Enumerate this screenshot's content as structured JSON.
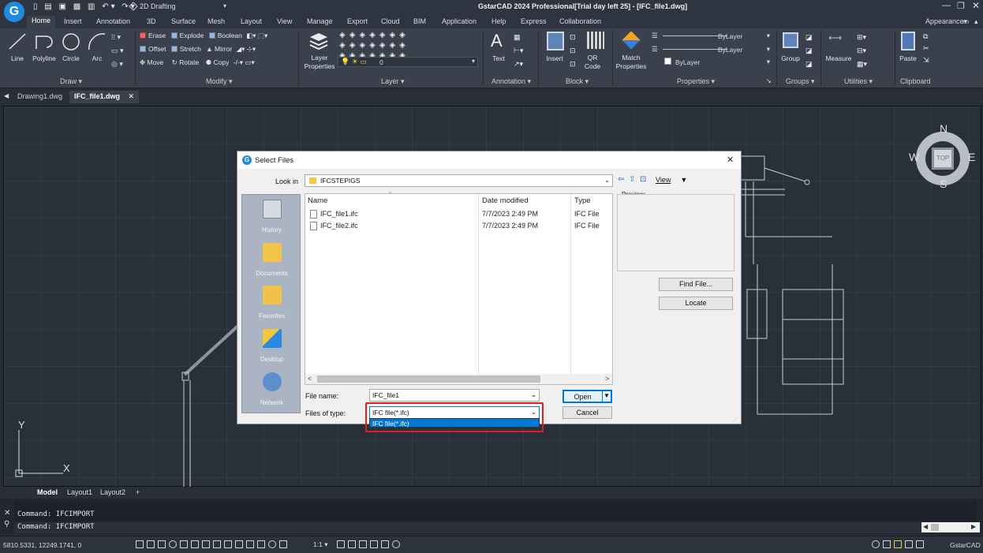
{
  "window": {
    "title": "GstarCAD 2024 Professional[Trial day left 25] - [IFC_file1.dwg]",
    "workspace": "2D Drafting",
    "appearance": "Appearance"
  },
  "ribbon_tabs": [
    "Home",
    "Insert",
    "Annotation",
    "3D",
    "Surface",
    "Mesh",
    "Layout",
    "View",
    "Manage",
    "Export",
    "Cloud",
    "BIM",
    "Application",
    "Help",
    "Express",
    "Collaboration"
  ],
  "panels": {
    "draw": {
      "title": "Draw",
      "tools": [
        "Line",
        "Polyline",
        "Circle",
        "Arc"
      ]
    },
    "modify": {
      "title": "Modify",
      "row1": [
        "Erase",
        "Explode",
        "Boolean"
      ],
      "row2": [
        "Offset",
        "Stretch",
        "Mirror"
      ],
      "row3": [
        "Move",
        "Rotate",
        "Copy"
      ]
    },
    "layer": {
      "title": "Layer",
      "props_label": "Layer Properties",
      "current_layer": "0"
    },
    "annotation": {
      "title": "Annotation",
      "text": "Text"
    },
    "block": {
      "title": "Block",
      "insert": "Insert",
      "qr": "QR Code"
    },
    "properties": {
      "title": "Properties",
      "match": "Match Properties",
      "color": "ByLayer",
      "linetype": "ByLayer",
      "lineweight": "ByLayer"
    },
    "groups": {
      "title": "Groups",
      "group": "Group"
    },
    "utilities": {
      "title": "Utilities",
      "measure": "Measure"
    },
    "clipboard": {
      "title": "Clipboard",
      "paste": "Paste"
    }
  },
  "doc_tabs": [
    "Drawing1.dwg",
    "IFC_file1.dwg"
  ],
  "viewcube": {
    "n": "N",
    "s": "S",
    "e": "E",
    "w": "W",
    "top": "TOP"
  },
  "axes": {
    "x": "X",
    "y": "Y"
  },
  "layout_tabs": [
    "Model",
    "Layout1",
    "Layout2",
    "+"
  ],
  "command_lines": [
    "Command: IFCIMPORT",
    "Command: IFCIMPORT"
  ],
  "status": {
    "coords": "5810.5331, 12249.1741, 0",
    "scale": "1:1",
    "app": "GstarCAD"
  },
  "dialog": {
    "title": "Select Files",
    "look_in_label": "Look in",
    "look_in_value": "IFCSTEPIGS",
    "view_label": "View",
    "places": [
      "History",
      "Documents",
      "Favorites",
      "Desktop",
      "Network"
    ],
    "columns": {
      "name": "Name",
      "date": "Date modified",
      "type": "Type"
    },
    "files": [
      {
        "name": "IFC_file1.ifc",
        "date": "7/7/2023 2:49 PM",
        "type": "IFC File"
      },
      {
        "name": "IFC_file2.ifc",
        "date": "7/7/2023 2:49 PM",
        "type": "IFC File"
      }
    ],
    "preview_label": "Preview:",
    "find_file": "Find File...",
    "locate": "Locate",
    "file_name_label": "File name:",
    "file_name_value": "IFC_file1",
    "files_of_type_label": "Files of type:",
    "files_of_type_value": "IFC file(*.ifc)",
    "dropdown_options": [
      "IFC file(*.ifc)"
    ],
    "open": "Open",
    "cancel": "Cancel"
  },
  "colors": {
    "accent": "#0078d7",
    "highlight_border": "#e02020",
    "background": "#262c35"
  }
}
